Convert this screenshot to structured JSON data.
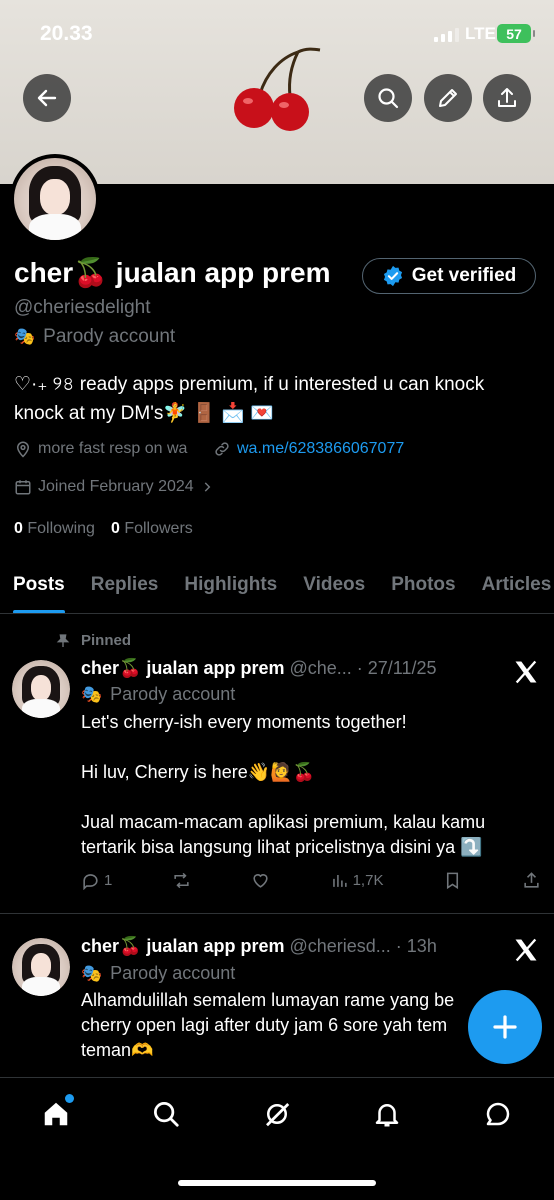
{
  "status_bar": {
    "time": "20.33",
    "network": "LTE",
    "battery": "57"
  },
  "profile": {
    "name": "cher🍒 jualan app prem",
    "verify_label": "Get verified",
    "handle": "@cheriesdelight",
    "parody_label": "Parody account",
    "bio_line1": "♡·₊ ୨৪ ready apps premium, if u interested u can knock",
    "bio_line2": "knock at my DM's🧚 🚪 📩 💌",
    "location": "more fast resp on wa",
    "website": "wa.me/6283866067077",
    "joined": "Joined February 2024",
    "following_count": "0",
    "following_label": "Following",
    "followers_count": "0",
    "followers_label": "Followers"
  },
  "tabs": [
    "Posts",
    "Replies",
    "Highlights",
    "Videos",
    "Photos",
    "Articles"
  ],
  "posts": [
    {
      "pinned_label": "Pinned",
      "name": "cher🍒 jualan app prem",
      "handle_time": "@che... · 27/11/25",
      "parody_label": "Parody account",
      "line1": "Let's cherry-ish every moments together!",
      "line2": "Hi luv, Cherry is here👋🙋🍒",
      "line3": "Jual macam-macam aplikasi premium, kalau kamu",
      "line4": "tertarik bisa langsung lihat pricelistnya disini ya ⤵️",
      "replies": "1",
      "views": "1,7K"
    },
    {
      "name": "cher🍒 jualan app prem",
      "handle_time": "@cheriesd... · 13h",
      "parody_label": "Parody account",
      "line1": "Alhamdulillah semalem lumayan rame yang be",
      "line2": "cherry open lagi after duty jam 6 sore yah tem",
      "line3": "teman🫶"
    }
  ],
  "colors": {
    "accent": "#1d9bf0",
    "background": "#000000",
    "muted": "#71767b"
  }
}
